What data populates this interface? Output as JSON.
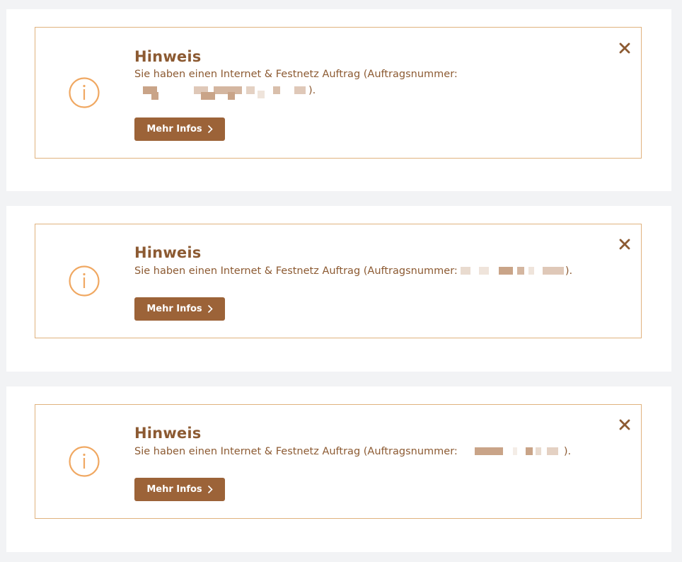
{
  "notices": [
    {
      "title": "Hinweis",
      "message_before": "Sie haben einen Internet & Festnetz Auftrag (Auftragsnummer:",
      "message_after": ").",
      "button_label": "Mehr Infos",
      "icon": "info-icon",
      "close_icon": "close-icon"
    },
    {
      "title": "Hinweis",
      "message_before": "Sie haben einen Internet & Festnetz Auftrag (Auftragsnummer:",
      "message_after": ").",
      "button_label": "Mehr Infos",
      "icon": "info-icon",
      "close_icon": "close-icon"
    },
    {
      "title": "Hinweis",
      "message_before": "Sie haben einen Internet & Festnetz Auftrag (Auftragsnummer:",
      "message_after": ").",
      "button_label": "Mehr Infos",
      "icon": "info-icon",
      "close_icon": "close-icon"
    }
  ],
  "colors": {
    "page_background": "#f2f3f5",
    "card_background": "#ffffff",
    "border": "#e0b27e",
    "text": "#8c5a32",
    "icon": "#f0a862",
    "button": "#9c6338",
    "button_text": "#ffffff"
  }
}
